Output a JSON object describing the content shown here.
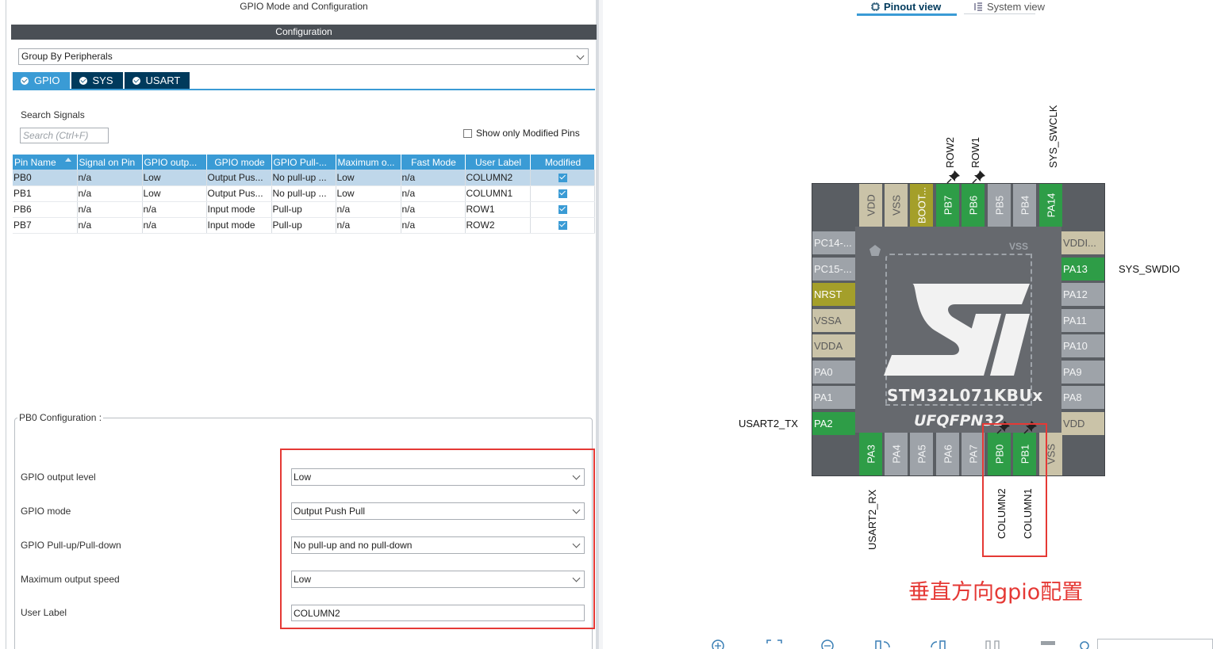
{
  "left_panel": {
    "title": "GPIO Mode and Configuration",
    "config_header": "Configuration",
    "group_by": "Group By Peripherals",
    "tabs": [
      {
        "label": "GPIO",
        "active": true
      },
      {
        "label": "SYS",
        "active": false
      },
      {
        "label": "USART",
        "active": false
      }
    ],
    "search_label": "Search Signals",
    "search_placeholder": "Search (Ctrl+F)",
    "show_modified_label": "Show only Modified Pins",
    "table": {
      "headers": [
        "Pin Name",
        "Signal on Pin",
        "GPIO outp...",
        "GPIO mode",
        "GPIO Pull-...",
        "Maximum o...",
        "Fast Mode",
        "User Label",
        "Modified"
      ],
      "rows": [
        [
          "PB0",
          "n/a",
          "Low",
          "Output Pus...",
          "No pull-up ...",
          "Low",
          "n/a",
          "COLUMN2"
        ],
        [
          "PB1",
          "n/a",
          "Low",
          "Output Pus...",
          "No pull-up ...",
          "Low",
          "n/a",
          "COLUMN1"
        ],
        [
          "PB6",
          "n/a",
          "n/a",
          "Input mode",
          "Pull-up",
          "n/a",
          "n/a",
          "ROW1"
        ],
        [
          "PB7",
          "n/a",
          "n/a",
          "Input mode",
          "Pull-up",
          "n/a",
          "n/a",
          "ROW2"
        ]
      ]
    },
    "pb0_config": {
      "title": "PB0 Configuration :",
      "fields": [
        {
          "label": "GPIO output level",
          "value": "Low"
        },
        {
          "label": "GPIO mode",
          "value": "Output Push Pull"
        },
        {
          "label": "GPIO Pull-up/Pull-down",
          "value": "No pull-up and no pull-down"
        },
        {
          "label": "Maximum output speed",
          "value": "Low"
        }
      ],
      "user_label": {
        "label": "User Label",
        "value": "COLUMN2"
      }
    }
  },
  "right_panel": {
    "tabs": {
      "pinout": "Pinout view",
      "system": "System view"
    },
    "chip": {
      "name": "STM32L071KBUx",
      "package": "UFQFPN32",
      "die_vss": "VSS"
    },
    "pins": {
      "top": [
        "VDD",
        "VSS",
        "BOOT...",
        "PB7",
        "PB6",
        "PB5",
        "PB4",
        "PA14"
      ],
      "left": [
        "PC14-...",
        "PC15-...",
        "NRST",
        "VSSA",
        "VDDA",
        "PA0",
        "PA1",
        "PA2"
      ],
      "bottom": [
        "PA3",
        "PA4",
        "PA5",
        "PA6",
        "PA7",
        "PB0",
        "PB1",
        "VSS"
      ],
      "right": [
        "VDDI...",
        "PA13",
        "PA12",
        "PA11",
        "PA10",
        "PA9",
        "PA8",
        "VDD"
      ]
    },
    "signals": {
      "row2": "ROW2",
      "row1": "ROW1",
      "sys_swclk": "SYS_SWCLK",
      "sys_swdio": "SYS_SWDIO",
      "usart2_tx": "USART2_TX",
      "usart2_rx": "USART2_RX",
      "column2": "COLUMN2",
      "column1": "COLUMN1"
    },
    "annotation": "垂直方向gpio配置",
    "colors": {
      "assigned_pin": "#2e9d47",
      "power_pin": "#cac3a8",
      "reset_pin": "#a49f2a",
      "free_pin": "#9ea3a9",
      "highlight": "#e53935",
      "accent": "#3a9bd5"
    }
  }
}
